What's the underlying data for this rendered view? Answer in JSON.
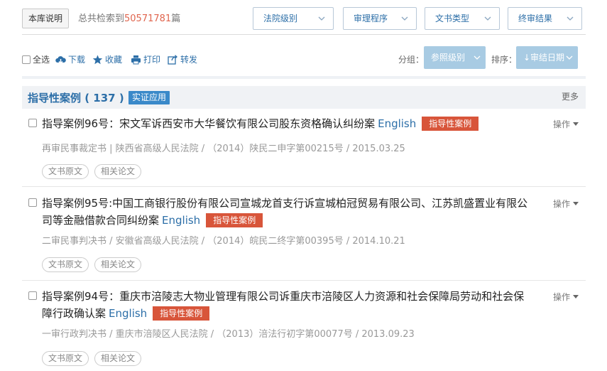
{
  "top": {
    "about_label": "本库说明",
    "total_prefix": "总共检索到",
    "total_count": "50571781",
    "total_suffix": "篇",
    "filters": [
      "法院级别",
      "审理程序",
      "文书类型",
      "终审结果"
    ]
  },
  "toolbar": {
    "select_all": "全选",
    "download": "下载",
    "favorite": "收藏",
    "print": "打印",
    "forward": "转发",
    "group_label": "分组：",
    "group_value": "参照级别",
    "sort_label": "排序：",
    "sort_value": "↓审结日期"
  },
  "section": {
    "title": "指导性案例 ( 137 )",
    "tag": "实证应用",
    "more": "更多"
  },
  "cases": [
    {
      "title": "指导案例96号：宋文军诉西安市大华餐饮有限公司股东资格确认纠纷案",
      "english": "English",
      "badge": "指导性案例",
      "op": "操作",
      "meta": "再审民事裁定书 | 陕西省高级人民法院 / （2014）陕民二申字第00215号 / 2015.03.25",
      "pill1": "文书原文",
      "pill2": "相关论文"
    },
    {
      "title": "指导案例95号:中国工商银行股份有限公司宣城龙首支行诉宣城柏冠贸易有限公司、江苏凯盛置业有限公司等金融借款合同纠纷案",
      "english": "English",
      "badge": "指导性案例",
      "op": "操作",
      "meta": "二审民事判决书 / 安徽省高级人民法院 / （2014）皖民二终字第00395号 / 2014.10.21",
      "pill1": "文书原文",
      "pill2": "相关论文"
    },
    {
      "title": "指导案例94号：重庆市涪陵志大物业管理有限公司诉重庆市涪陵区人力资源和社会保障局劳动和社会保障行政确认案",
      "english": "English",
      "badge": "指导性案例",
      "op": "操作",
      "meta": "一审行政判决书 / 重庆市涪陵区人民法院 / （2013）涪法行初字第00077号 / 2013.09.23",
      "pill1": "文书原文",
      "pill2": "相关论文"
    }
  ],
  "colors": {
    "accent_blue": "#2d6fa8",
    "count_red": "#e0654e",
    "badge_red": "#d8553a",
    "dropdown_blue": "#a8cbe3"
  }
}
